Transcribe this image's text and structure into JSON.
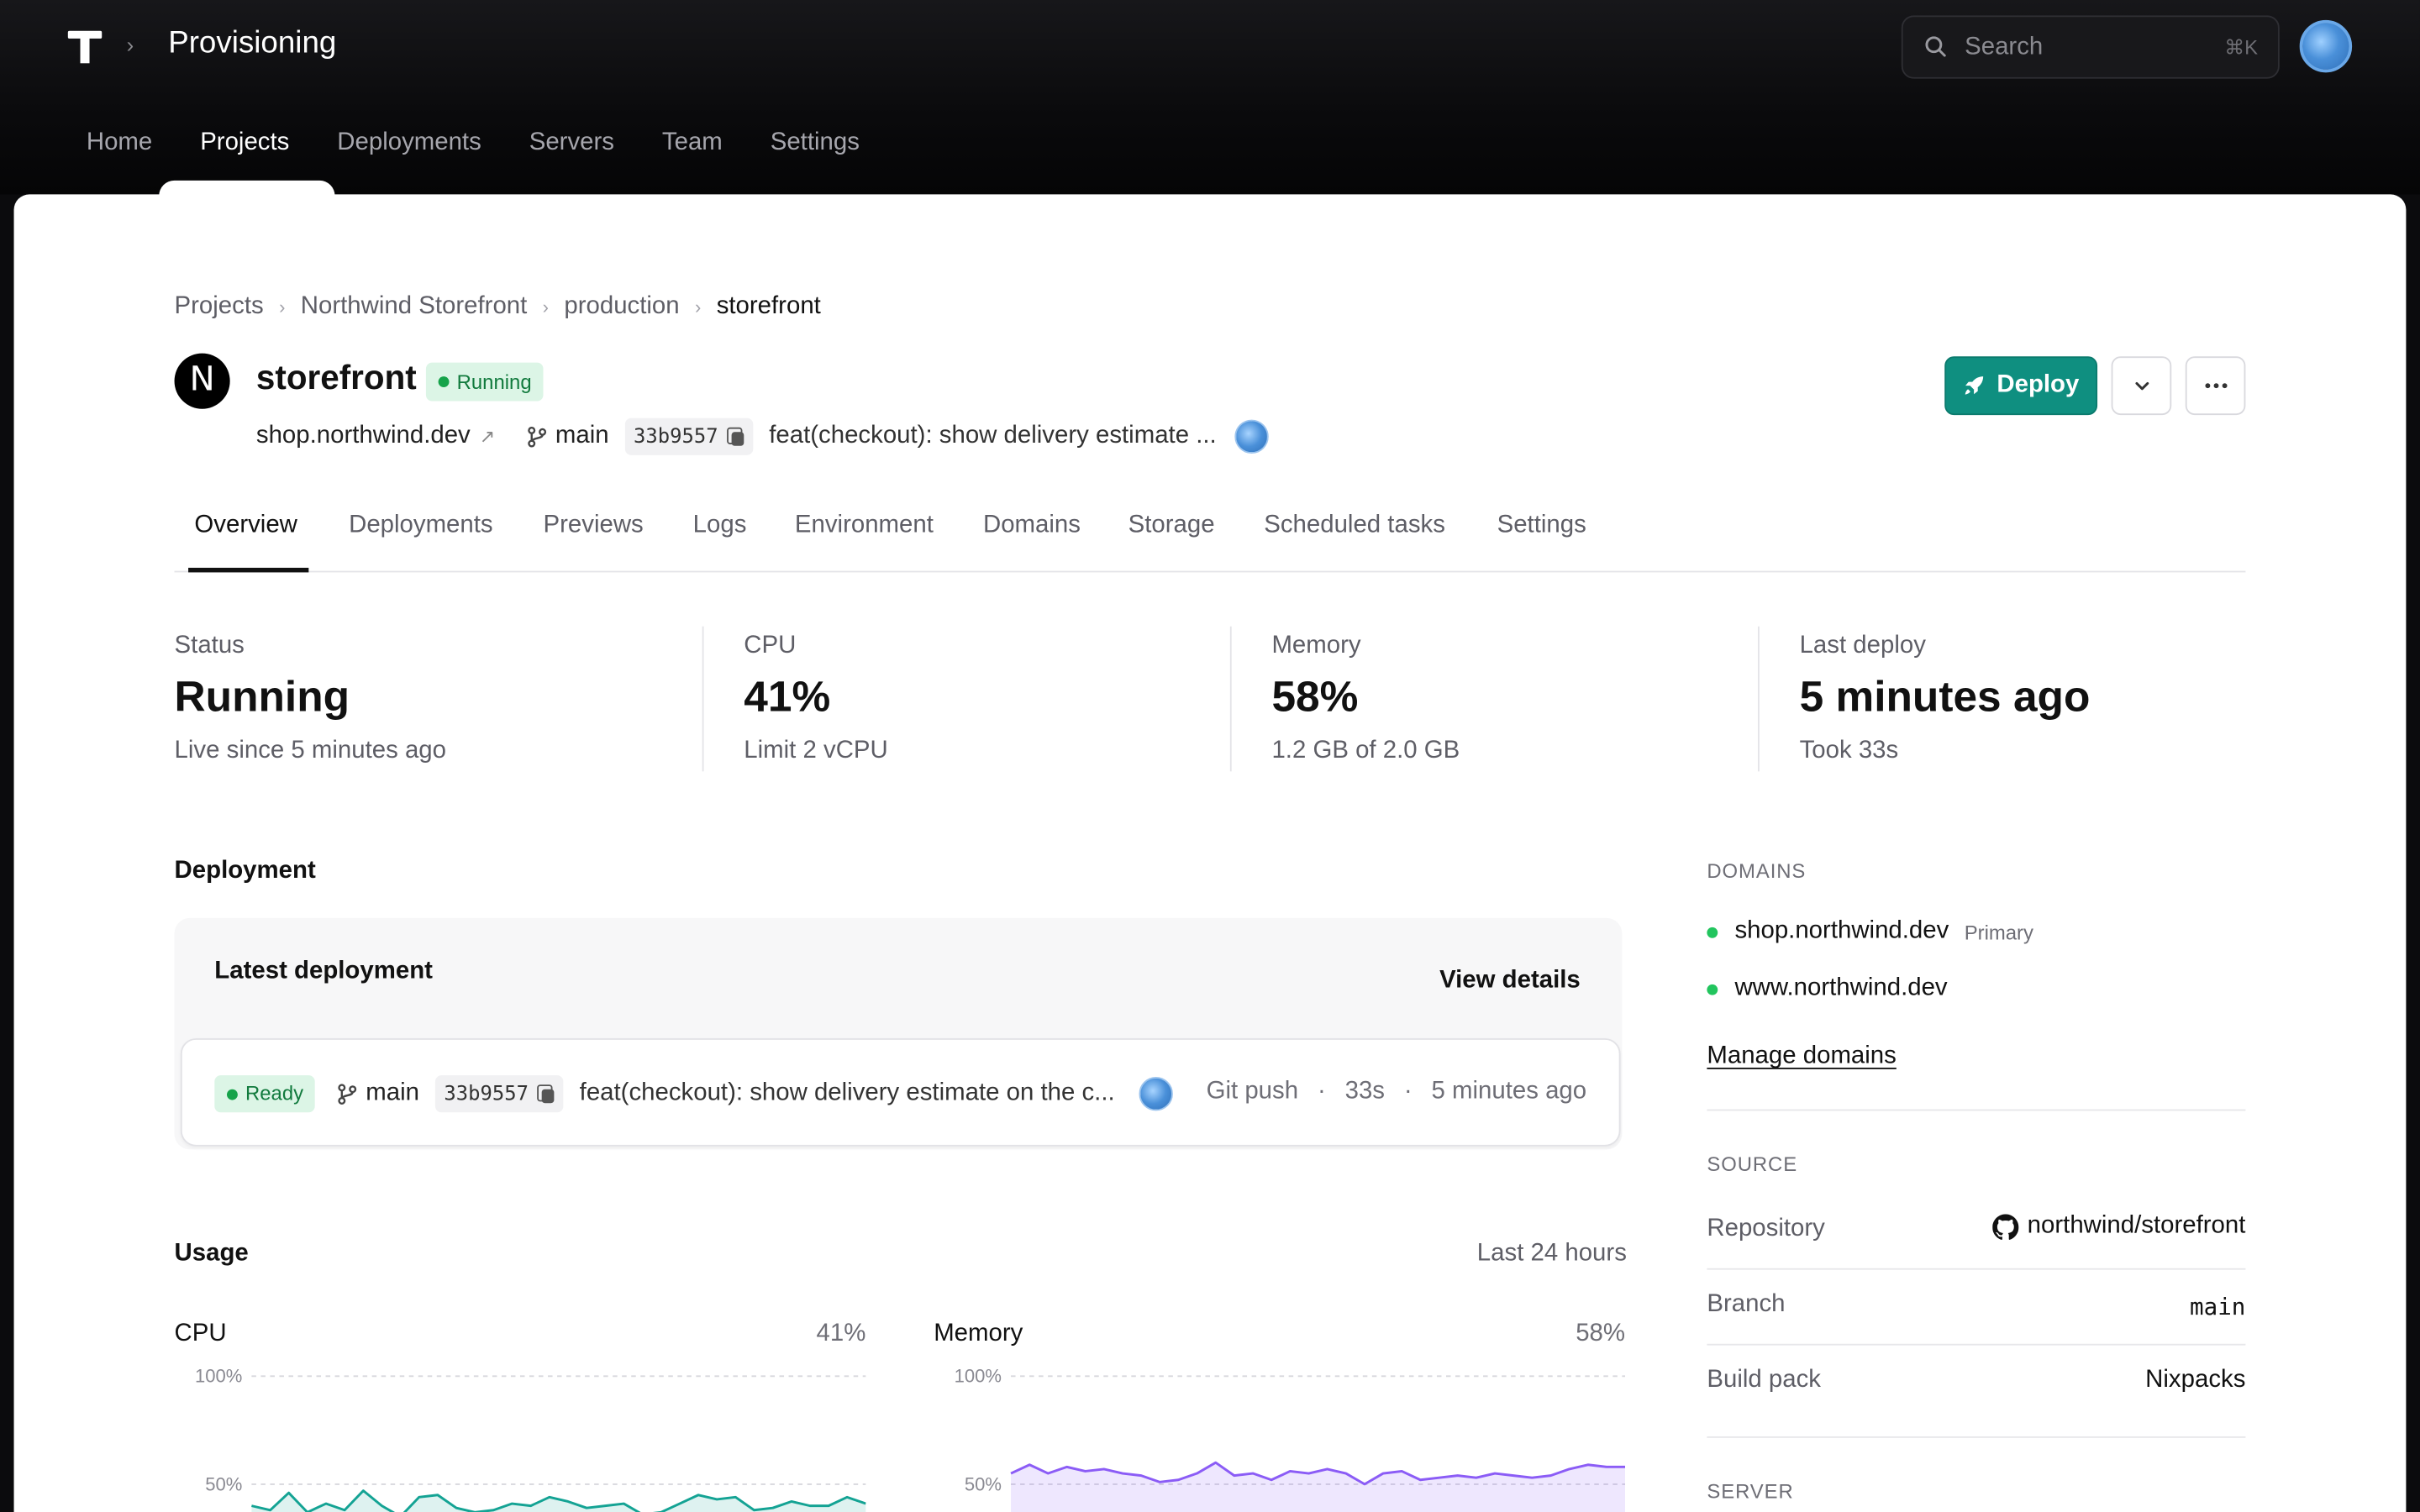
{
  "header": {
    "app_title": "Provisioning",
    "search_placeholder": "Search",
    "search_shortcut": "⌘K",
    "nav": [
      "Home",
      "Projects",
      "Deployments",
      "Servers",
      "Team",
      "Settings"
    ],
    "active_nav": "Projects"
  },
  "breadcrumb": [
    "Projects",
    "Northwind Storefront",
    "production",
    "storefront"
  ],
  "project": {
    "logo_letter": "N",
    "name": "storefront",
    "status": "Running",
    "domain": "shop.northwind.dev",
    "branch": "main",
    "commit": "33b9557",
    "commit_message": "feat(checkout): show delivery estimate ..."
  },
  "actions": {
    "deploy_label": "Deploy"
  },
  "tabs": [
    "Overview",
    "Deployments",
    "Previews",
    "Logs",
    "Environment",
    "Domains",
    "Storage",
    "Scheduled tasks",
    "Settings"
  ],
  "stats": [
    {
      "label": "Status",
      "value": "Running",
      "sub": "Live since 5 minutes ago"
    },
    {
      "label": "CPU",
      "value": "41%",
      "sub": "Limit 2 vCPU"
    },
    {
      "label": "Memory",
      "value": "58%",
      "sub": "1.2 GB of 2.0 GB"
    },
    {
      "label": "Last deploy",
      "value": "5 minutes ago",
      "sub": "Took 33s"
    }
  ],
  "deployment": {
    "section_title": "Deployment",
    "card_title": "Latest deployment",
    "view_details": "View details",
    "status": "Ready",
    "branch": "main",
    "commit": "33b9557",
    "message": "feat(checkout): show delivery estimate on the c...",
    "trigger": "Git push",
    "duration": "33s",
    "time": "5 minutes ago"
  },
  "usage": {
    "section_title": "Usage",
    "range": "Last 24 hours",
    "cpu": {
      "title": "CPU",
      "value": "41%"
    },
    "memory": {
      "title": "Memory",
      "value": "58%"
    },
    "tick_100": "100%",
    "tick_50": "50%"
  },
  "domains": {
    "label": "DOMAINS",
    "items": [
      {
        "name": "shop.northwind.dev",
        "tag": "Primary"
      },
      {
        "name": "www.northwind.dev",
        "tag": ""
      }
    ],
    "manage": "Manage domains"
  },
  "source": {
    "label": "SOURCE",
    "repository_label": "Repository",
    "repository": "northwind/storefront",
    "branch_label": "Branch",
    "branch": "main",
    "buildpack_label": "Build pack",
    "buildpack": "Nixpacks"
  },
  "server": {
    "label": "SERVER"
  },
  "colors": {
    "accent": "#0f8f80",
    "running_bg": "#dcf5e6",
    "running_fg": "#117a3d",
    "cpu_line": "#14a394",
    "memory_line": "#8b5cf6"
  },
  "chart_data": [
    {
      "type": "area",
      "title": "CPU",
      "ylim": [
        0,
        100
      ],
      "y_ticks": [
        "100%",
        "50%"
      ],
      "values": [
        40,
        38,
        46,
        37,
        41,
        38,
        47,
        40,
        35,
        44,
        45,
        39,
        37,
        38,
        41,
        40,
        44,
        42,
        39,
        40,
        41,
        36,
        37,
        41,
        45,
        43,
        44,
        38,
        39,
        42,
        40,
        40,
        44,
        41
      ]
    },
    {
      "type": "area",
      "title": "Memory",
      "ylim": [
        0,
        100
      ],
      "y_ticks": [
        "100%",
        "50%"
      ],
      "values": [
        55,
        59,
        55,
        58,
        56,
        57,
        55,
        54,
        51,
        52,
        55,
        60,
        54,
        55,
        52,
        56,
        55,
        57,
        55,
        50,
        55,
        56,
        52,
        53,
        54,
        53,
        55,
        54,
        53,
        54,
        57,
        59,
        58,
        58
      ]
    }
  ]
}
